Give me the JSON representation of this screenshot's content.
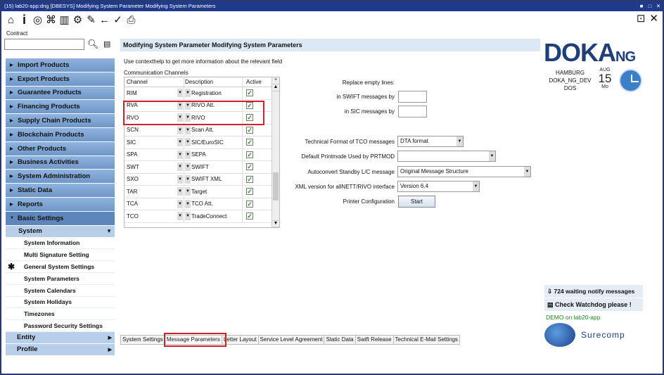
{
  "window": {
    "title": "(15) lab20-app:dng [DBESYS] Modifying System Parameter Modifying System Parameters",
    "controls": [
      "■",
      "□",
      "✕"
    ]
  },
  "toolbar": {
    "icons": [
      "home-icon",
      "info-icon",
      "target-icon",
      "tree-icon",
      "book-icon",
      "tree-settings-icon",
      "edit-icon",
      "back-icon",
      "check-icon",
      "print-icon"
    ]
  },
  "contract": {
    "label": "Contract",
    "value": ""
  },
  "nav": {
    "items": [
      {
        "label": "Import Products"
      },
      {
        "label": "Export Products"
      },
      {
        "label": "Guarantee Products"
      },
      {
        "label": "Financing Products"
      },
      {
        "label": "Supply Chain Products"
      },
      {
        "label": "Blockchain Products"
      },
      {
        "label": "Other Products"
      },
      {
        "label": "Business Activities"
      },
      {
        "label": "System Administration"
      },
      {
        "label": "Static Data"
      },
      {
        "label": "Reports"
      },
      {
        "label": "Basic Settings"
      }
    ],
    "sub": {
      "label": "System"
    },
    "leaves": [
      {
        "label": "System Information"
      },
      {
        "label": "Multi Signature Setting"
      },
      {
        "label": "General System Settings"
      },
      {
        "label": "System Parameters"
      },
      {
        "label": "System Calendars"
      },
      {
        "label": "System Holidays"
      },
      {
        "label": "Timezones"
      },
      {
        "label": "Password Security Settings"
      }
    ],
    "entity": "Entity",
    "profile": "Profile"
  },
  "page": {
    "title": "Modifying System Parameter Modifying System Parameters",
    "hint": "Use contexthelp to get more information about the relevant field",
    "cc_label": "Communication Channels"
  },
  "table": {
    "headers": [
      "Channel",
      "Description",
      "Active"
    ],
    "rows": [
      {
        "channel": "RIM",
        "desc": "Registration",
        "active": true
      },
      {
        "channel": "RVA",
        "desc": "RIVO Att.",
        "active": true
      },
      {
        "channel": "RVO",
        "desc": "RIVO",
        "active": true
      },
      {
        "channel": "SCN",
        "desc": "Scan Att.",
        "active": true
      },
      {
        "channel": "SIC",
        "desc": "SIC/EuroSIC",
        "active": true
      },
      {
        "channel": "SPA",
        "desc": "SEPA",
        "active": true
      },
      {
        "channel": "SWT",
        "desc": "SWIFT",
        "active": true
      },
      {
        "channel": "SXO",
        "desc": "SWIFT XML",
        "active": true
      },
      {
        "channel": "TAR",
        "desc": "Target",
        "active": true
      },
      {
        "channel": "TCA",
        "desc": "TCO Att.",
        "active": true
      },
      {
        "channel": "TCO",
        "desc": "TradeConnect",
        "active": true
      }
    ]
  },
  "form": {
    "replace_empty": "Replace empty lines:",
    "swift_label": "in SWIFT messages by",
    "sic_label": "in SIC messages by",
    "tech_label": "Technical Format of TCO messages",
    "tech_value": "DTA format",
    "print_label": "Default Printmode Used by PRTMOD",
    "print_value": "",
    "auto_label": "Autoconvert Standby L/C message",
    "auto_value": "Original Message Structure",
    "xml_label": "XML version for allNETT/RIVO interface",
    "xml_value": "Version 6.4",
    "printer_label": "Printer Configuration",
    "start_label": "Start"
  },
  "brand": {
    "logo": "DOKA",
    "logo_ng": "NG",
    "location": [
      "HAMBURG",
      "DOKA_NG_DEV",
      "DOS"
    ],
    "month": "AUG",
    "day": "15",
    "weekday": "Mo",
    "notify": "724 waiting notify messages",
    "watchdog": "Check Watchdog please !",
    "demo": "DEMO on lab20-app",
    "surecomp": "Surecomp"
  },
  "tabs": [
    "System Settings",
    "Message Parameters",
    "Letter Layout",
    "Service Level Agreement",
    "Static Data",
    "Swift Release",
    "Technical E-Mail Settings"
  ],
  "colors": {
    "titlebar": "#1f3a8a",
    "nav": "#7ba2d2",
    "highlight": "#d0202a",
    "accent": "#1e3f7a"
  }
}
